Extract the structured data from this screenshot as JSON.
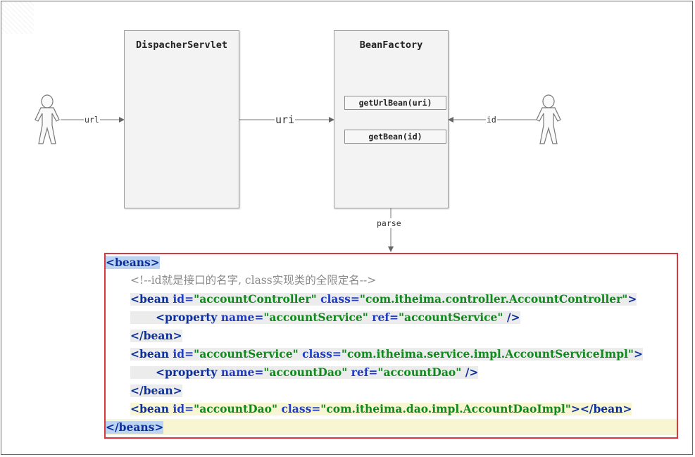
{
  "diagram": {
    "dispatcher": {
      "title": "DispacherServlet"
    },
    "factory": {
      "title": "BeanFactory",
      "methods": [
        "getUrlBean(uri)",
        "getBean(id)"
      ]
    },
    "edges": {
      "url": "url",
      "uri": "uri",
      "id": "id",
      "parse": "parse"
    }
  },
  "code": {
    "lines": [
      [
        {
          "t": "<",
          "c": "tg"
        },
        {
          "t": "beans",
          "c": "tg"
        },
        {
          "t": ">",
          "c": "tg"
        }
      ],
      [
        {
          "t": "<!--id就是接口的名字, class实现类的全限定名-->",
          "c": "cm"
        }
      ],
      [
        {
          "t": "<",
          "c": "tg"
        },
        {
          "t": "bean",
          "c": "tg"
        },
        {
          "t": " id=",
          "c": "an"
        },
        {
          "t": "\"accountController\"",
          "c": "av"
        },
        {
          "t": " class=",
          "c": "an"
        },
        {
          "t": "\"com.itheima.controller.AccountController\"",
          "c": "av"
        },
        {
          "t": ">",
          "c": "tg"
        }
      ],
      [
        {
          "t": "<",
          "c": "tg"
        },
        {
          "t": "property",
          "c": "tg"
        },
        {
          "t": " name=",
          "c": "an"
        },
        {
          "t": "\"accountService\"",
          "c": "av"
        },
        {
          "t": " ref=",
          "c": "an"
        },
        {
          "t": "\"accountService\"",
          "c": "av"
        },
        {
          "t": " />",
          "c": "tg"
        }
      ],
      [
        {
          "t": "</",
          "c": "tg"
        },
        {
          "t": "bean",
          "c": "tg"
        },
        {
          "t": ">",
          "c": "tg"
        }
      ],
      [
        {
          "t": "<",
          "c": "tg"
        },
        {
          "t": "bean",
          "c": "tg"
        },
        {
          "t": " id=",
          "c": "an"
        },
        {
          "t": "\"accountService\"",
          "c": "av"
        },
        {
          "t": " class=",
          "c": "an"
        },
        {
          "t": "\"com.itheima.service.impl.AccountServiceImpl\"",
          "c": "av"
        },
        {
          "t": ">",
          "c": "tg"
        }
      ],
      [
        {
          "t": "<",
          "c": "tg"
        },
        {
          "t": "property",
          "c": "tg"
        },
        {
          "t": " name=",
          "c": "an"
        },
        {
          "t": "\"accountDao\"",
          "c": "av"
        },
        {
          "t": " ref=",
          "c": "an"
        },
        {
          "t": "\"accountDao\"",
          "c": "av"
        },
        {
          "t": " />",
          "c": "tg"
        }
      ],
      [
        {
          "t": "</",
          "c": "tg"
        },
        {
          "t": "bean",
          "c": "tg"
        },
        {
          "t": ">",
          "c": "tg"
        }
      ],
      [
        {
          "t": "<",
          "c": "tg"
        },
        {
          "t": "bean",
          "c": "tg"
        },
        {
          "t": " id=",
          "c": "an"
        },
        {
          "t": "\"accountDao\"",
          "c": "av"
        },
        {
          "t": " class=",
          "c": "an"
        },
        {
          "t": "\"com.itheima.dao.impl.AccountDaoImpl\"",
          "c": "av"
        },
        {
          "t": "></",
          "c": "tg"
        },
        {
          "t": "bean",
          "c": "tg"
        },
        {
          "t": ">",
          "c": "tg"
        }
      ],
      [
        {
          "t": "</",
          "c": "tg"
        },
        {
          "t": "beans",
          "c": "tg"
        },
        {
          "t": ">",
          "c": "tg"
        }
      ]
    ]
  }
}
